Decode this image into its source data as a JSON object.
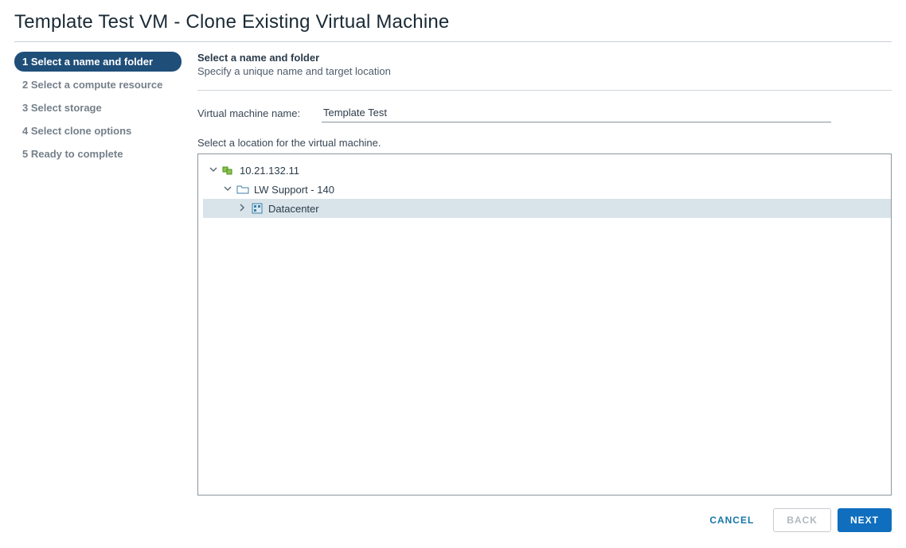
{
  "title": "Template Test VM - Clone Existing Virtual Machine",
  "steps": [
    {
      "label": "1 Select a name and folder",
      "active": true
    },
    {
      "label": "2 Select a compute resource",
      "active": false
    },
    {
      "label": "3 Select storage",
      "active": false
    },
    {
      "label": "4 Select clone options",
      "active": false
    },
    {
      "label": "5 Ready to complete",
      "active": false
    }
  ],
  "panel": {
    "heading": "Select a name and folder",
    "subheading": "Specify a unique name and target location",
    "vm_name_label": "Virtual machine name:",
    "vm_name_value": "Template Test",
    "location_label": "Select a location for the virtual machine."
  },
  "tree": {
    "root": {
      "label": "10.21.132.11"
    },
    "child1": {
      "label": "LW Support - 140"
    },
    "child2": {
      "label": "Datacenter"
    }
  },
  "buttons": {
    "cancel": "CANCEL",
    "back": "BACK",
    "next": "NEXT"
  }
}
